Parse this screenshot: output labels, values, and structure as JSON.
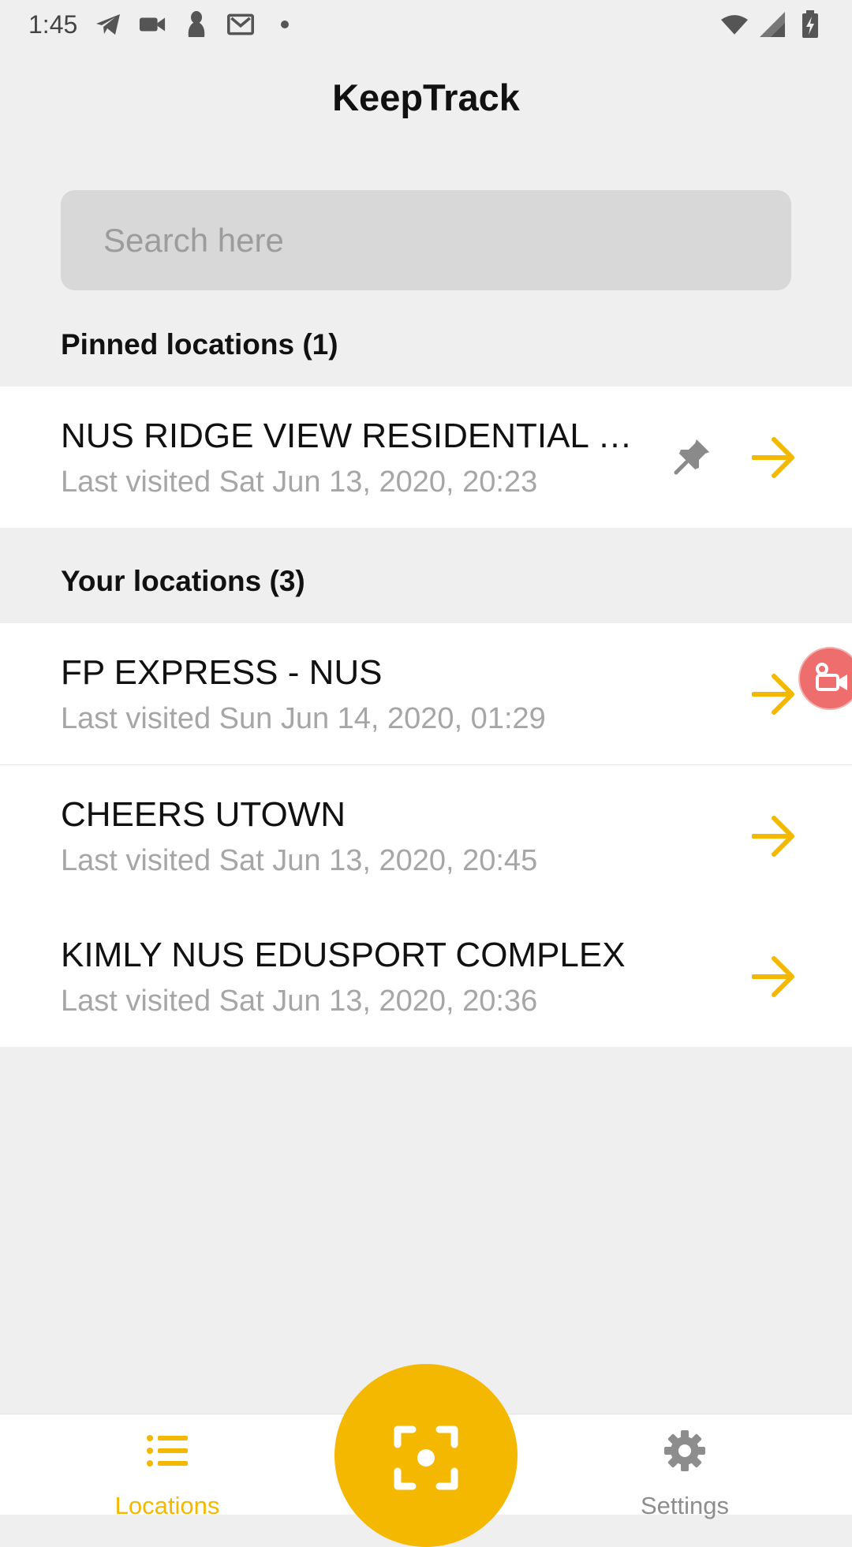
{
  "status_bar": {
    "time": "1:45",
    "left_icons": [
      "telegram-icon",
      "video-camera-icon",
      "penguin-icon",
      "gmail-icon",
      "dot-icon"
    ],
    "right_icons": [
      "wifi-icon",
      "signal-icon",
      "battery-charging-icon"
    ]
  },
  "app": {
    "title": "KeepTrack"
  },
  "search": {
    "placeholder": "Search here",
    "value": ""
  },
  "pinned": {
    "header": "Pinned locations (1)",
    "items": [
      {
        "name": "NUS RIDGE VIEW RESIDENTIAL C...",
        "last_visited": "Last visited Sat Jun 13, 2020, 20:23",
        "pinned": true
      }
    ]
  },
  "yours": {
    "header": "Your locations (3)",
    "items": [
      {
        "name": "FP EXPRESS - NUS",
        "last_visited": "Last visited Sun Jun 14, 2020, 01:29"
      },
      {
        "name": "CHEERS UTOWN",
        "last_visited": "Last visited Sat Jun 13, 2020, 20:45"
      },
      {
        "name": "KIMLY NUS EDUSPORT COMPLEX",
        "last_visited": "Last visited Sat Jun 13, 2020, 20:36"
      }
    ]
  },
  "bottom_nav": {
    "locations_label": "Locations",
    "settings_label": "Settings",
    "scan_icon": "qr-scan-icon"
  },
  "colors": {
    "accent": "#f5b800",
    "background": "#efefef",
    "subtext": "#a6a6a6",
    "pin": "#8a8a8a",
    "record": "#ee6e6e"
  }
}
